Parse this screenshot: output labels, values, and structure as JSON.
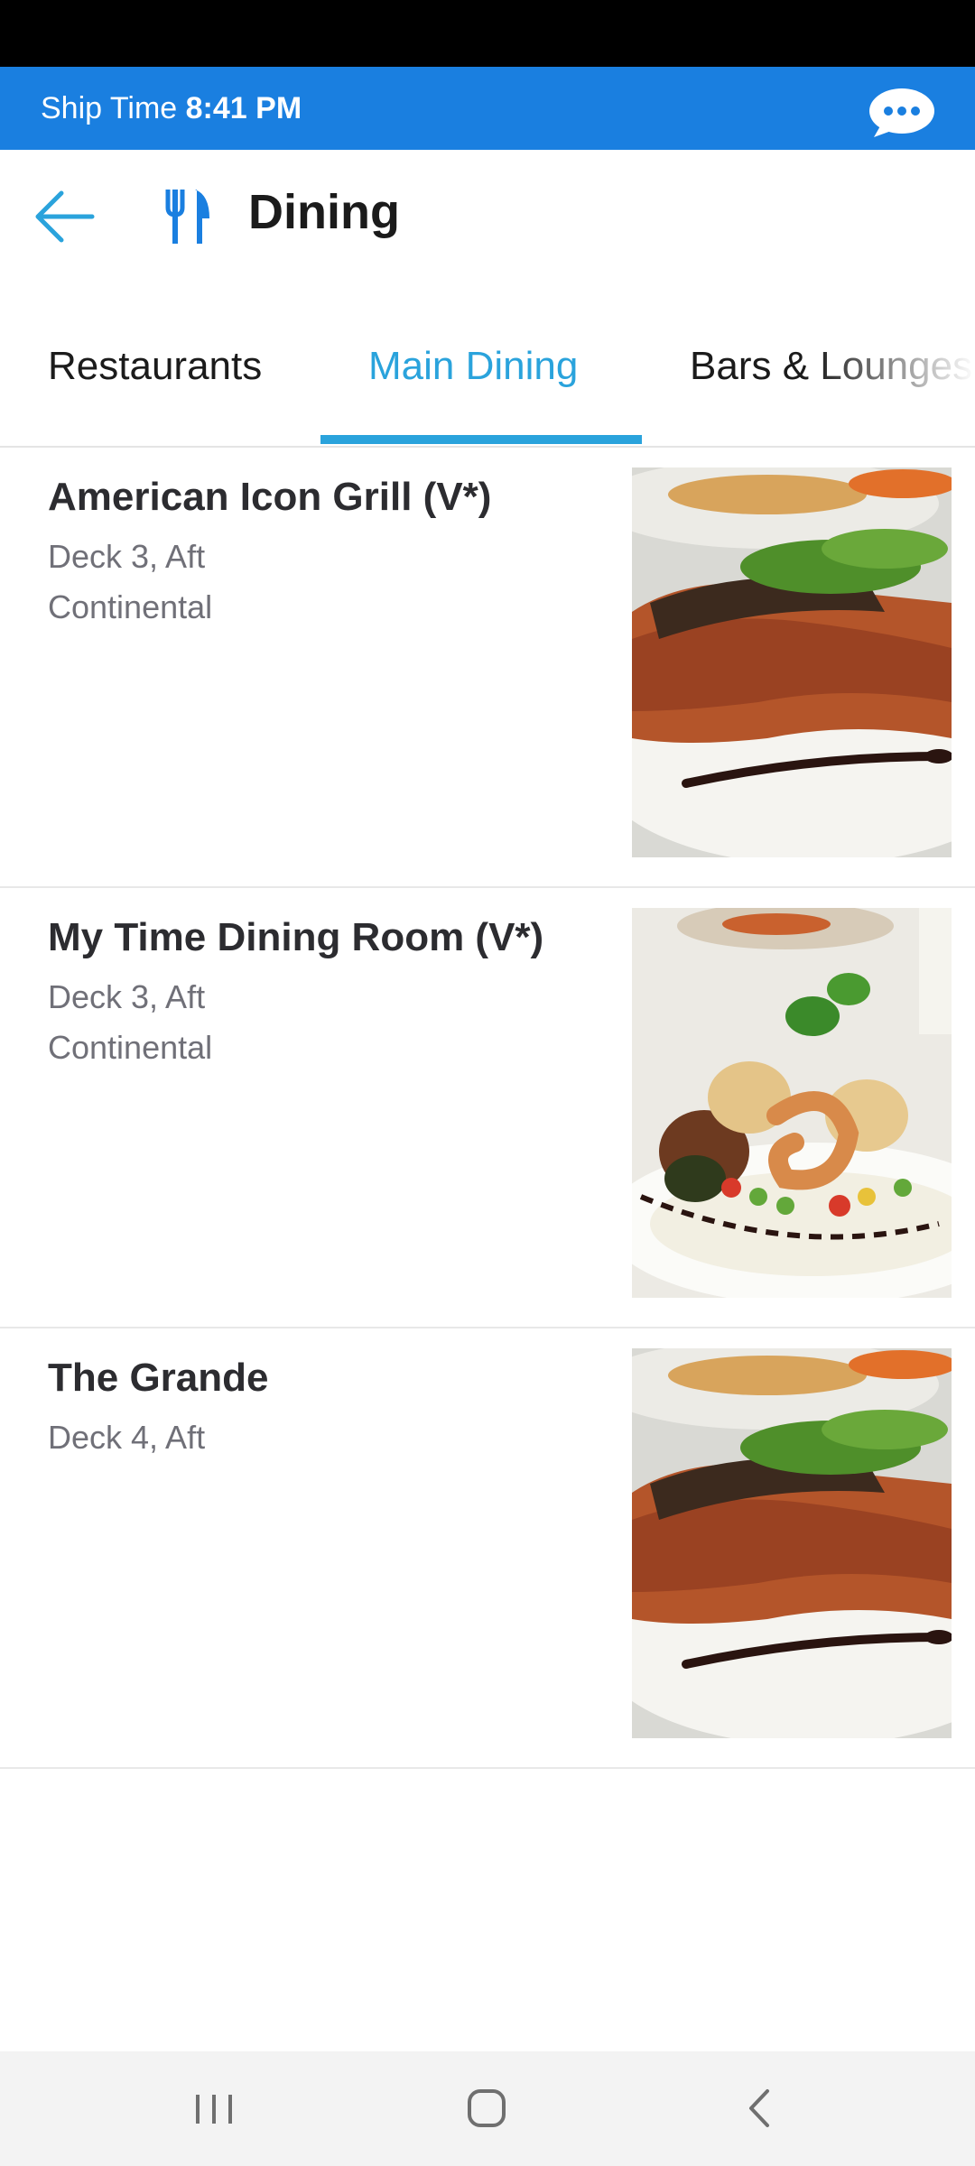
{
  "ship_bar": {
    "label": "Ship Time",
    "time": "8:41 PM",
    "color": "#1a7fe0",
    "chat_icon": "chat-bubble-icon"
  },
  "header": {
    "title": "Dining",
    "back_icon": "back-arrow-icon",
    "title_icon": "fork-knife-icon",
    "accent": "#2aa3dc"
  },
  "tabs": [
    {
      "label": "Restaurants",
      "selected": false
    },
    {
      "label": "Main Dining",
      "selected": true
    },
    {
      "label": "Bars & Lounges",
      "selected": false
    }
  ],
  "venues": [
    {
      "name": "American Icon Grill (V*)",
      "deck": "Deck 3, Aft",
      "cuisine": "Continental",
      "image": "salmon-dish-photo"
    },
    {
      "name": "My Time Dining Room (V*)",
      "deck": "Deck 3, Aft",
      "cuisine": "Continental",
      "image": "seafood-dish-photo"
    },
    {
      "name": "The Grande",
      "deck": "Deck 4, Aft",
      "cuisine": "",
      "image": "salmon-dish-photo"
    }
  ],
  "nav_bar": {
    "recents_icon": "recents-icon",
    "home_icon": "home-icon",
    "back_icon": "nav-back-icon"
  }
}
